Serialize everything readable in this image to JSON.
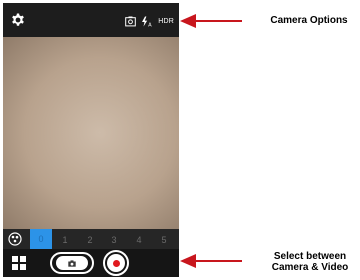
{
  "camera": {
    "top_bar": {
      "settings_icon": "gear-icon",
      "options": {
        "camera_switch_icon": "camera-switch-icon",
        "flash_icon": "flash-auto-icon",
        "flash_label": "A",
        "hdr_label": "HDR"
      }
    },
    "filters": {
      "effects_icon": "filter-effects-icon",
      "items": [
        "0",
        "1",
        "2",
        "3",
        "4",
        "5"
      ],
      "selected": "0"
    },
    "bottom_bar": {
      "gallery_icon": "grid-icon",
      "camera_mode_icon": "camera-icon",
      "video_mode_icon": "record-icon"
    }
  },
  "annotations": {
    "camera_options": "Camera Options",
    "select_line1": "Select between",
    "select_line2": "Camera & Video"
  },
  "colors": {
    "accent_blue": "#2c93e8",
    "record_red": "#e0191e",
    "arrow_red": "#c8161d"
  }
}
